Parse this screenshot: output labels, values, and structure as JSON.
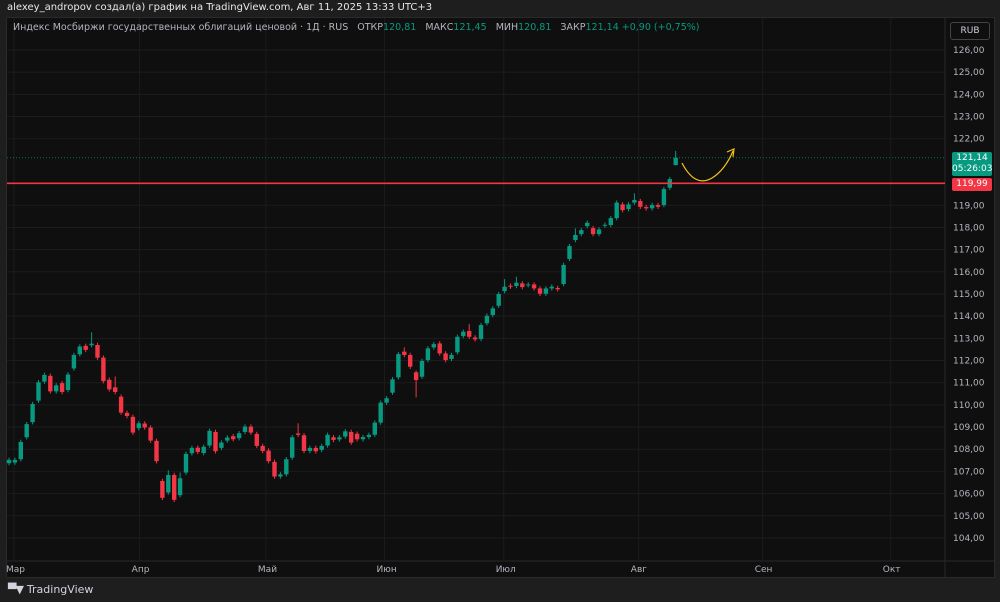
{
  "header": {
    "caption": "alexey_andropov создал(а) график на TradingView.com, Авг 11, 2025 13:33 UTC+3"
  },
  "legend": {
    "instrument": "Индекс Мосбиржи государственных облигаций ценовой · 1Д · RUS",
    "open_label": "ОТКР",
    "open": "120,81",
    "high_label": "МАКС",
    "high": "121,45",
    "low_label": "МИН",
    "low": "120,81",
    "close_label": "ЗАКР",
    "close": "121,14",
    "change": "+0,90 (+0,75%)"
  },
  "price_axis": {
    "currency": "RUB",
    "labels": [
      "126,00",
      "125,00",
      "124,00",
      "123,00",
      "122,00",
      "119,00",
      "118,00",
      "117,00",
      "116,00",
      "115,00",
      "114,00",
      "113,00",
      "112,00",
      "111,00",
      "110,00",
      "109,00",
      "108,00",
      "107,00",
      "106,00",
      "105,00",
      "104,00"
    ],
    "last_price": "121,14",
    "countdown": "05:26:03",
    "level_price": "119,99"
  },
  "time_axis": {
    "labels": [
      "Мар",
      "Апр",
      "Май",
      "Июн",
      "Июл",
      "Авг",
      "Сен",
      "Окт"
    ]
  },
  "footer": {
    "brand": "TradingView",
    "logo_mark": "17"
  },
  "colors": {
    "up": "#089981",
    "down": "#f23645",
    "level": "#f23645",
    "annotation": "#f5c518"
  },
  "chart_data": {
    "type": "candlestick",
    "interval": "1D",
    "ylim": [
      103.5,
      127.2
    ],
    "level": 119.99,
    "last": 121.14,
    "month_start_index": {
      "Мар": 0,
      "Апр": 21.3,
      "Май": 42.7,
      "Июн": 62.8,
      "Июл": 83,
      "Авг": 105.9,
      "Сен": 126.9,
      "Окт": 148.6
    },
    "candles": [
      [
        107.37,
        107.52
      ],
      [
        107.4,
        107.52
      ],
      [
        107.55,
        108.33
      ],
      [
        108.54,
        109.13
      ],
      [
        109.22,
        110.04
      ],
      [
        110.19,
        111.02
      ],
      [
        111.05,
        111.35
      ],
      [
        111.31,
        110.61
      ],
      [
        110.61,
        110.88
      ],
      [
        110.98,
        110.58
      ],
      [
        110.67,
        111.37
      ],
      [
        111.64,
        112.25
      ],
      [
        112.28,
        112.63
      ],
      [
        112.66,
        112.48
      ],
      [
        112.69,
        112.76,
        113.27
      ],
      [
        112.7,
        112.13
      ],
      [
        112.13,
        111.07
      ],
      [
        111.13,
        110.7
      ],
      [
        110.79,
        110.58,
        111.28
      ],
      [
        110.37,
        109.65
      ],
      [
        109.64,
        109.5
      ],
      [
        109.46,
        108.75
      ],
      [
        108.95,
        109.17
      ],
      [
        109.16,
        108.98
      ],
      [
        108.98,
        108.39
      ],
      [
        108.38,
        107.46
      ],
      [
        106.57,
        105.81
      ],
      [
        106.05,
        106.84,
        107.05
      ],
      [
        106.84,
        105.72
      ],
      [
        105.93,
        106.69,
        106.95
      ],
      [
        106.95,
        107.79
      ],
      [
        107.82,
        108.06
      ],
      [
        108.07,
        107.88
      ],
      [
        107.83,
        108.11
      ],
      [
        108.17,
        108.83
      ],
      [
        108.78,
        107.91
      ],
      [
        108.06,
        108.3
      ],
      [
        108.39,
        108.53
      ],
      [
        108.59,
        108.45
      ],
      [
        108.5,
        108.72
      ],
      [
        108.78,
        109.02
      ],
      [
        109.02,
        108.75
      ],
      [
        108.69,
        108.15
      ],
      [
        108.15,
        107.92
      ],
      [
        107.94,
        107.46
      ],
      [
        107.43,
        106.77
      ],
      [
        106.77,
        106.87
      ],
      [
        106.87,
        107.55
      ],
      [
        107.62,
        108.54
      ],
      [
        108.71,
        108.65,
        109.17
      ],
      [
        108.63,
        107.92
      ],
      [
        107.92,
        108.06
      ],
      [
        108.06,
        107.91
      ],
      [
        107.97,
        108.15
      ],
      [
        108.17,
        108.65
      ],
      [
        108.54,
        108.42
      ],
      [
        108.44,
        108.54
      ],
      [
        108.57,
        108.81
      ],
      [
        108.78,
        108.3
      ],
      [
        108.7,
        108.45
      ],
      [
        108.45,
        108.55
      ],
      [
        108.55,
        108.65
      ],
      [
        108.65,
        109.2
      ],
      [
        109.2,
        110.1
      ],
      [
        110.1,
        110.3
      ],
      [
        110.55,
        111.15
      ],
      [
        111.24,
        112.29
      ],
      [
        112.4,
        112.25,
        112.59
      ],
      [
        112.25,
        111.72
      ],
      [
        111.47,
        111.12,
        111.55,
        110.34
      ],
      [
        111.27,
        111.98
      ],
      [
        112.02,
        112.55
      ],
      [
        112.59,
        112.74
      ],
      [
        112.77,
        112.32
      ],
      [
        112.32,
        112.02
      ],
      [
        112.07,
        112.25
      ],
      [
        112.37,
        113.07
      ],
      [
        113.1,
        113.3
      ],
      [
        113.33,
        113.07,
        113.65
      ],
      [
        113.04,
        112.95
      ],
      [
        112.97,
        113.6
      ],
      [
        113.68,
        114.02
      ],
      [
        114.05,
        114.35
      ],
      [
        114.47,
        115.0
      ],
      [
        115.13,
        115.33,
        115.67
      ],
      [
        115.37,
        115.33
      ],
      [
        115.36,
        115.51,
        115.78
      ],
      [
        115.48,
        115.31
      ],
      [
        115.4,
        115.43
      ],
      [
        115.43,
        115.25
      ],
      [
        115.25,
        115.01
      ],
      [
        115.01,
        115.25
      ],
      [
        115.25,
        115.33
      ],
      [
        115.27,
        115.21
      ],
      [
        115.45,
        116.31
      ],
      [
        116.58,
        117.16
      ],
      [
        117.43,
        117.66,
        117.96
      ],
      [
        117.7,
        117.88
      ],
      [
        118.06,
        118.21
      ],
      [
        117.97,
        117.7
      ],
      [
        117.7,
        117.91
      ],
      [
        118.08,
        118.12
      ],
      [
        118.11,
        118.42
      ],
      [
        118.42,
        119.12
      ],
      [
        119.04,
        118.78
      ],
      [
        118.83,
        119.04
      ],
      [
        119.12,
        119.24,
        119.54
      ],
      [
        119.19,
        118.93
      ],
      [
        118.92,
        118.86
      ],
      [
        118.86,
        119.01
      ],
      [
        119.01,
        118.93
      ],
      [
        119.01,
        119.73
      ],
      [
        119.79,
        120.18
      ],
      [
        120.81,
        121.14,
        121.45,
        120.81
      ]
    ]
  }
}
